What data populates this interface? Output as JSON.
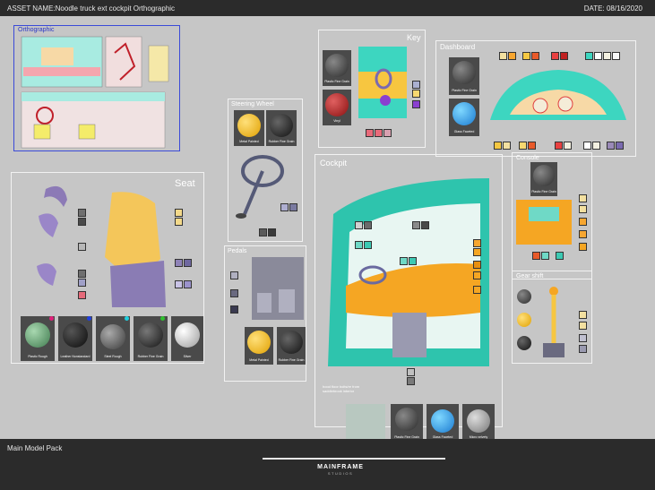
{
  "header": {
    "asset_label": "ASSET NAME:Noodle truck ext cockpit Orthographic",
    "date_label": "DATE: 08/16/2020"
  },
  "panels": {
    "orthographic": "Orthographic",
    "seat": "Seat",
    "steering": "Steering Wheel",
    "pedals": "Pedals",
    "key": "Key",
    "cockpit": "Cockpit",
    "dashboard": "Dashboard",
    "console": "Console",
    "gearshift": "Gear shift"
  },
  "materials": {
    "plastic_fine_grain": "Plastic Fine Grain",
    "vinyl": "Vinyl",
    "metal_painted": "Metal Painted",
    "rubber_fine_grain": "Rubber Fine Grain",
    "glass_faceted": "Glass Faceted",
    "plastic_rough": "Plastic Rough",
    "leather_nonstandard": "Leather Nonstandard",
    "metal": "Metal",
    "steel_rough": "Steel Rough",
    "silver": "Silver",
    "micro_velvety": "Micro velvety",
    "cockpit_note": "hood floor bolts/re from saddlebrook interior"
  },
  "footer": {
    "pack_label": "Main Model Pack",
    "logo": "MAINFRAME",
    "logo_sub": "STUDIOS"
  },
  "colors": {
    "background": "#c6c6c6",
    "frame": "#2b2b2b",
    "teal": "#3cc9b3",
    "orange": "#f5a623",
    "yellow": "#f3d34a"
  }
}
